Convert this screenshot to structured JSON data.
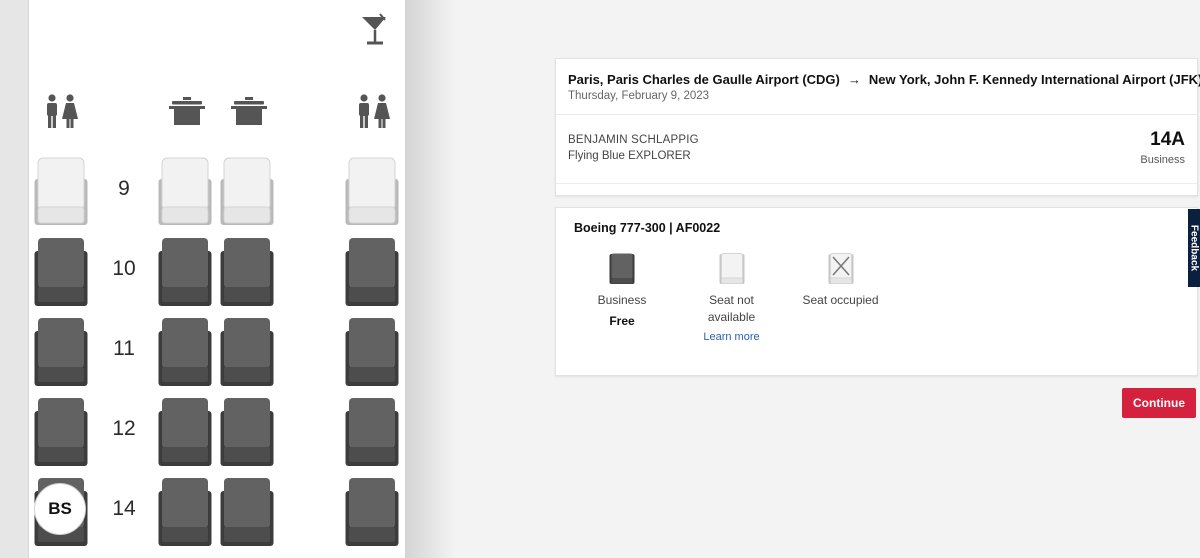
{
  "seat_map": {
    "facility_icons": [
      "bar-icon",
      "lavatory-icon",
      "galley-icon",
      "galley-icon",
      "lavatory-icon"
    ],
    "rows": [
      {
        "number": "9",
        "status": "not-available"
      },
      {
        "number": "10",
        "status": "business-free"
      },
      {
        "number": "11",
        "status": "business-free"
      },
      {
        "number": "12",
        "status": "business-free"
      },
      {
        "number": "14",
        "status": "business-free"
      }
    ],
    "occupant_badge": "BS"
  },
  "flight": {
    "origin": "Paris, Paris Charles de Gaulle Airport (CDG)",
    "destination": "New York, John F. Kennedy International Airport (JFK)",
    "date": "Thursday, February 9, 2023",
    "passenger_name": "BENJAMIN SCHLAPPIG",
    "passenger_tier": "Flying Blue EXPLORER",
    "seat": "14A",
    "seat_cabin": "Business"
  },
  "legend": {
    "aircraft": "Boeing 777-300 | AF0022",
    "business_label": "Business",
    "business_price": "Free",
    "not_available_label": "Seat not available",
    "learn_more": "Learn more",
    "occupied_label": "Seat occupied"
  },
  "actions": {
    "continue_label": "Continue"
  },
  "feedback_label": "Feedback",
  "colors": {
    "accent": "#d4213d",
    "seat_business": "#5f5f5f",
    "seat_unavailable": "#efefef",
    "feedback_tab": "#0b1f3f",
    "link": "#2d5fa8"
  }
}
